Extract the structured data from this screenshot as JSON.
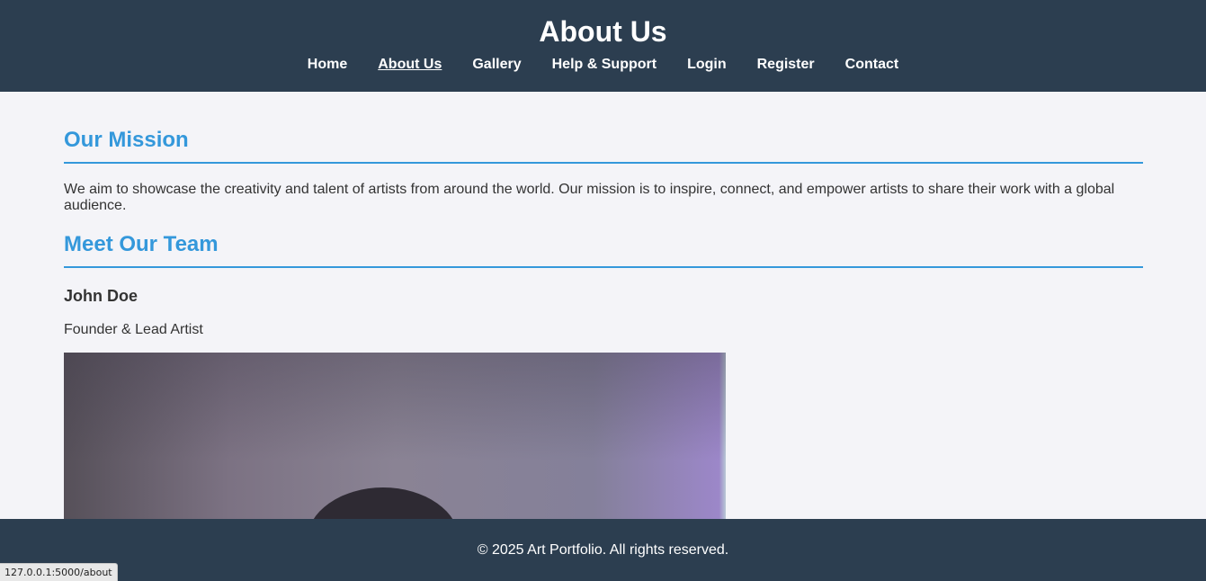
{
  "header": {
    "title": "About Us",
    "nav": [
      {
        "label": "Home"
      },
      {
        "label": "About Us",
        "active": true
      },
      {
        "label": "Gallery"
      },
      {
        "label": "Help & Support"
      },
      {
        "label": "Login"
      },
      {
        "label": "Register"
      },
      {
        "label": "Contact"
      }
    ]
  },
  "mission": {
    "heading": "Our Mission",
    "text": "We aim to showcase the creativity and talent of artists from around the world. Our mission is to inspire, connect, and empower artists to share their work with a global audience."
  },
  "team": {
    "heading": "Meet Our Team",
    "members": [
      {
        "name": "John Doe",
        "role": "Founder & Lead Artist"
      }
    ]
  },
  "footer": {
    "text": "© 2025 Art Portfolio. All rights reserved."
  },
  "status_bar": {
    "url": "127.0.0.1:5000/about"
  },
  "colors": {
    "header_bg": "#2c3e50",
    "accent": "#3498db",
    "page_bg": "#f4f4f8"
  }
}
